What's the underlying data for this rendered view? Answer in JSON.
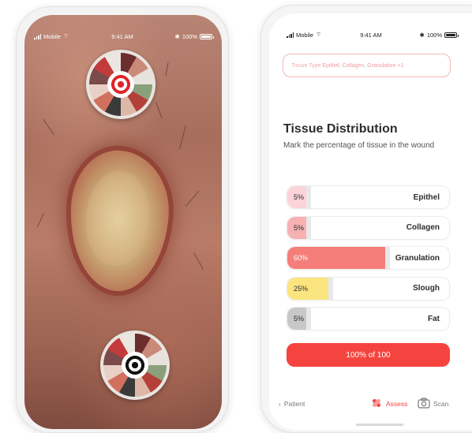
{
  "left_phone": {
    "status": {
      "carrier": "Mobile",
      "time": "9:41 AM",
      "battery": "100%"
    }
  },
  "right_phone": {
    "status": {
      "carrier": "Mobile",
      "time": "9:41 AM",
      "battery": "100%"
    },
    "tissue_type": {
      "label": "Tissue Type",
      "value": "Epithel, Collagen, Granulation +1"
    },
    "title": "Tissue Distribution",
    "subtitle": "Mark the percentage of tissue in the wound",
    "tissues": [
      {
        "name": "Epithel",
        "percent_label": "5%",
        "percent": 5,
        "color": "#fbd3d8"
      },
      {
        "name": "Collagen",
        "percent_label": "5%",
        "percent": 5,
        "color": "#f7b1b3"
      },
      {
        "name": "Granulation",
        "percent_label": "60%",
        "percent": 60,
        "color": "#f57e7a"
      },
      {
        "name": "Slough",
        "percent_label": "25%",
        "percent": 25,
        "color": "#fae581"
      },
      {
        "name": "Fat",
        "percent_label": "5%",
        "percent": 5,
        "color": "#c8c8c8"
      }
    ],
    "total_label": "100% of 100",
    "tabs": {
      "patient": "Patient",
      "assess": "Assess",
      "scan": "Scan"
    },
    "colors": {
      "accent": "#f5443f"
    },
    "icons": {
      "back": "chevron-left-icon",
      "assess": "bandage-icon",
      "scan": "camera-icon"
    }
  }
}
